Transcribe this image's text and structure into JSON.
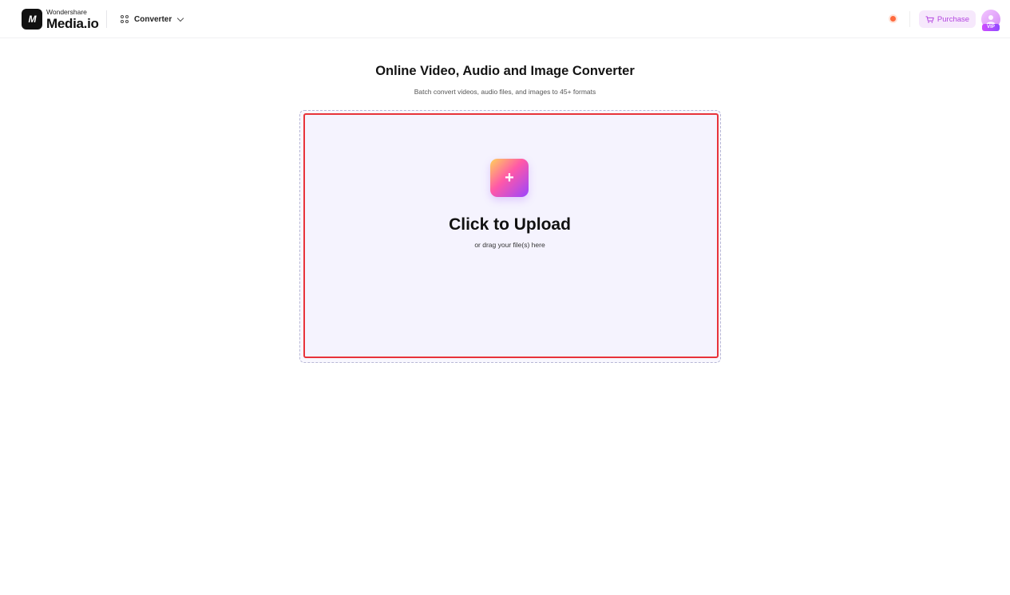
{
  "header": {
    "logo_small": "Wondershare",
    "logo_big": "Media.io",
    "logo_mark": "M",
    "nav_converter_label": "Converter",
    "purchase_label": "Purchase",
    "vip_badge": "VIP",
    "icons": [
      "grid-icon",
      "chevron-down-icon",
      "notification-dot-icon",
      "cart-icon",
      "avatar-icon"
    ]
  },
  "main": {
    "title": "Online Video, Audio and Image Converter",
    "subtitle": "Batch convert videos, audio files, and images to 45+ formats"
  },
  "upload": {
    "plus_symbol": "+",
    "title": "Click to Upload",
    "subtitle": "or drag your file(s) here"
  },
  "colors": {
    "accent_purple": "#b445e0",
    "upload_border": "#e8333a",
    "drop_bg": "#f5f3fe",
    "notification": "#ff6a3d"
  }
}
